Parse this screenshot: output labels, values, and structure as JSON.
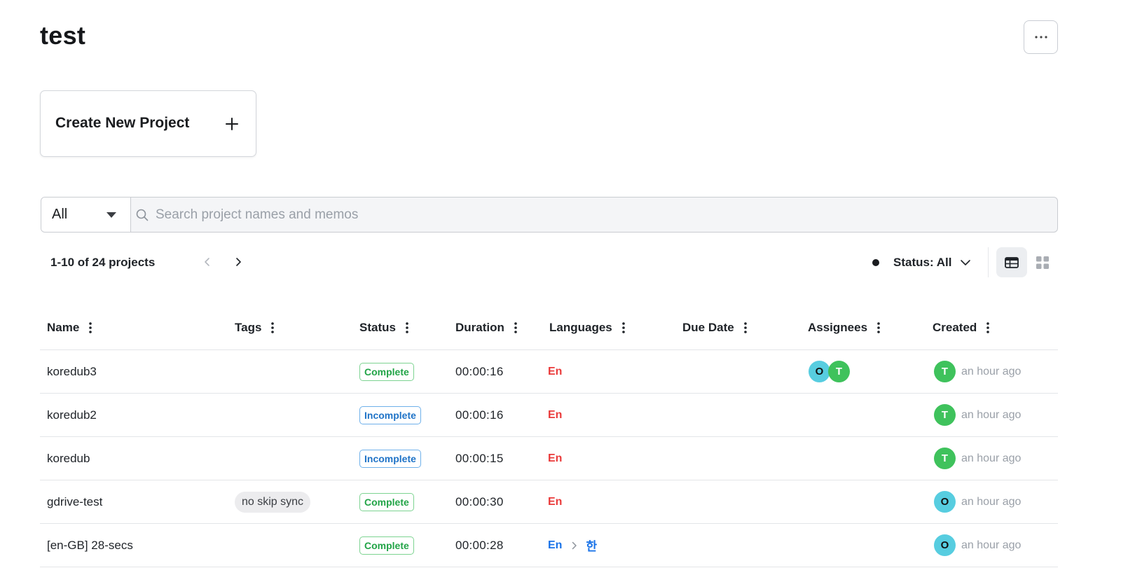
{
  "header": {
    "title": "test"
  },
  "create": {
    "label": "Create New Project"
  },
  "filter": {
    "selected": "All",
    "search_placeholder": "Search project names and memos"
  },
  "pagination": {
    "label": "1-10 of 24 projects"
  },
  "status_filter": {
    "label": "Status: All"
  },
  "columns": [
    {
      "key": "name",
      "label": "Name"
    },
    {
      "key": "tags",
      "label": "Tags"
    },
    {
      "key": "status",
      "label": "Status"
    },
    {
      "key": "duration",
      "label": "Duration"
    },
    {
      "key": "languages",
      "label": "Languages"
    },
    {
      "key": "due_date",
      "label": "Due Date"
    },
    {
      "key": "assignees",
      "label": "Assignees"
    },
    {
      "key": "created",
      "label": "Created"
    }
  ],
  "colors": {
    "complete": "#22a447",
    "incomplete": "#1f73c7",
    "lang_red": "#ea3b3b",
    "lang_blue": "#1a73e8",
    "avatar_t": "#3fc25c",
    "avatar_o": "#57cde0"
  },
  "rows": [
    {
      "name": "koredub3",
      "tag": "",
      "status": "Complete",
      "duration": "00:00:16",
      "source_lang": "En",
      "source_color": "red",
      "target_lang": "",
      "assignees": [
        "O",
        "T"
      ],
      "created_avatar": "T",
      "created": "an hour ago"
    },
    {
      "name": "koredub2",
      "tag": "",
      "status": "Incomplete",
      "duration": "00:00:16",
      "source_lang": "En",
      "source_color": "red",
      "target_lang": "",
      "assignees": [],
      "created_avatar": "T",
      "created": "an hour ago"
    },
    {
      "name": "koredub",
      "tag": "",
      "status": "Incomplete",
      "duration": "00:00:15",
      "source_lang": "En",
      "source_color": "red",
      "target_lang": "",
      "assignees": [],
      "created_avatar": "T",
      "created": "an hour ago"
    },
    {
      "name": "gdrive-test",
      "tag": "no skip sync",
      "status": "Complete",
      "duration": "00:00:30",
      "source_lang": "En",
      "source_color": "red",
      "target_lang": "",
      "assignees": [],
      "created_avatar": "O",
      "created": "an hour ago"
    },
    {
      "name": "[en-GB] 28-secs",
      "tag": "",
      "status": "Complete",
      "duration": "00:00:28",
      "source_lang": "En",
      "source_color": "blue",
      "target_lang": "한",
      "assignees": [],
      "created_avatar": "O",
      "created": "an hour ago"
    }
  ]
}
